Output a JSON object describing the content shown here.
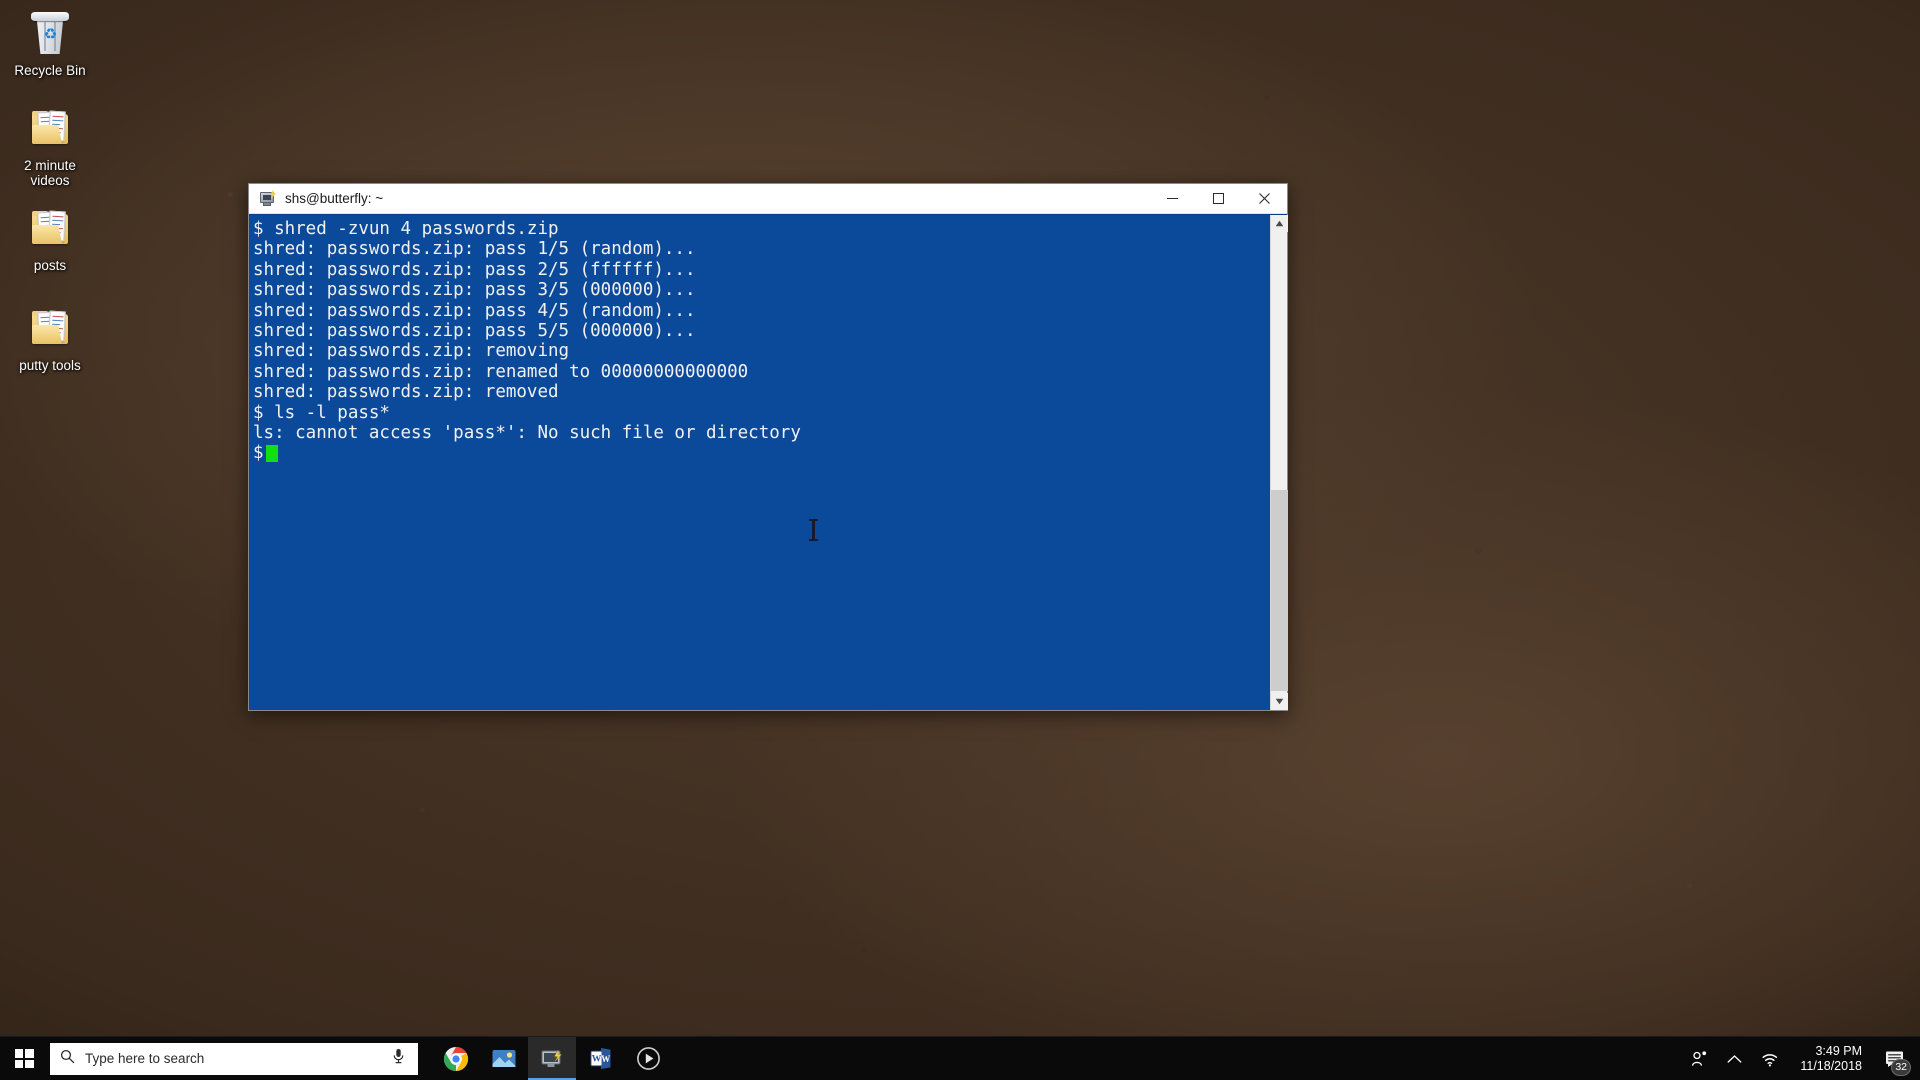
{
  "desktop": {
    "icons": [
      {
        "label": "Recycle Bin",
        "type": "recycle-bin"
      },
      {
        "label": "2 minute videos",
        "type": "folder"
      },
      {
        "label": "posts",
        "type": "folder"
      },
      {
        "label": "putty tools",
        "type": "folder"
      }
    ]
  },
  "window": {
    "title": "shs@butterfly: ~",
    "icon": "putty-terminal-icon",
    "controls": {
      "minimize": "minimize-icon",
      "maximize": "maximize-icon",
      "close": "close-icon"
    },
    "colors": {
      "terminal_background": "#0b4a9b",
      "terminal_foreground": "#f1f1f1",
      "cursor": "#10e010",
      "titlebar_background": "#ffffff"
    }
  },
  "terminal": {
    "lines": [
      "$ shred -zvun 4 passwords.zip",
      "shred: passwords.zip: pass 1/5 (random)...",
      "shred: passwords.zip: pass 2/5 (ffffff)...",
      "shred: passwords.zip: pass 3/5 (000000)...",
      "shred: passwords.zip: pass 4/5 (random)...",
      "shred: passwords.zip: pass 5/5 (000000)...",
      "shred: passwords.zip: removing",
      "shred: passwords.zip: renamed to 00000000000000",
      "shred: passwords.zip: removed",
      "$ ls -l pass*",
      "ls: cannot access 'pass*': No such file or directory"
    ],
    "prompt": "$",
    "cursor": "block-cursor"
  },
  "taskbar": {
    "start": "windows-logo-icon",
    "search": {
      "placeholder": "Type here to search",
      "icon": "search-icon",
      "mic": "microphone-icon"
    },
    "apps": [
      {
        "name": "chrome-icon",
        "label": "Google Chrome",
        "active": false
      },
      {
        "name": "photos-icon",
        "label": "Photos",
        "active": false
      },
      {
        "name": "putty-icon",
        "label": "PuTTY",
        "active": true
      },
      {
        "name": "word-icon",
        "label": "Microsoft Word",
        "active": false
      },
      {
        "name": "media-icon",
        "label": "Media Player",
        "active": false
      }
    ],
    "tray": {
      "people": "people-icon",
      "chevron": "chevron-up-icon",
      "network": "wifi-icon",
      "time": "3:49 PM",
      "date": "11/18/2018",
      "notifications_icon": "action-center-icon",
      "notifications_count": "32"
    }
  }
}
